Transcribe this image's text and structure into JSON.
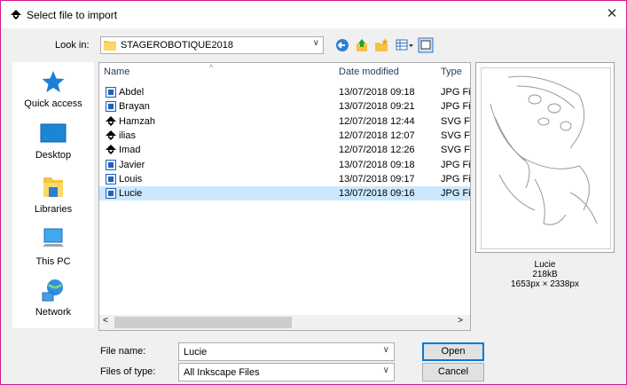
{
  "window": {
    "title": "Select file to import"
  },
  "lookin": {
    "label": "Look in:",
    "value": "STAGEROBOTIQUE2018"
  },
  "places": [
    {
      "label": "Quick access",
      "icon": "star-icon"
    },
    {
      "label": "Desktop",
      "icon": "desktop-icon"
    },
    {
      "label": "Libraries",
      "icon": "libraries-icon"
    },
    {
      "label": "This PC",
      "icon": "computer-icon"
    },
    {
      "label": "Network",
      "icon": "network-icon"
    }
  ],
  "columns": {
    "name": "Name",
    "date": "Date modified",
    "type": "Type"
  },
  "files": [
    {
      "name": "Abdel",
      "date": "13/07/2018 09:18",
      "type": "JPG Fi",
      "kind": "jpg"
    },
    {
      "name": "Brayan",
      "date": "13/07/2018 09:21",
      "type": "JPG Fi",
      "kind": "jpg"
    },
    {
      "name": "Hamzah",
      "date": "12/07/2018 12:44",
      "type": "SVG F",
      "kind": "svg"
    },
    {
      "name": "ilias",
      "date": "12/07/2018 12:07",
      "type": "SVG F",
      "kind": "svg"
    },
    {
      "name": "Imad",
      "date": "12/07/2018 12:26",
      "type": "SVG F",
      "kind": "svg"
    },
    {
      "name": "Javier",
      "date": "13/07/2018 09:18",
      "type": "JPG Fi",
      "kind": "jpg"
    },
    {
      "name": "Louis",
      "date": "13/07/2018 09:17",
      "type": "JPG Fi",
      "kind": "jpg"
    },
    {
      "name": "Lucie",
      "date": "13/07/2018 09:16",
      "type": "JPG Fi",
      "kind": "jpg",
      "selected": true
    }
  ],
  "preview": {
    "name": "Lucie",
    "size": "218kB",
    "dimensions": "1653px × 2338px"
  },
  "filename": {
    "label": "File name:",
    "value": "Lucie"
  },
  "filetype": {
    "label": "Files of type:",
    "value": "All Inkscape Files"
  },
  "buttons": {
    "open": "Open",
    "cancel": "Cancel"
  },
  "colors": {
    "accent": "#0078d7",
    "selection": "#cce8ff",
    "window_border": "#d01c8b"
  }
}
